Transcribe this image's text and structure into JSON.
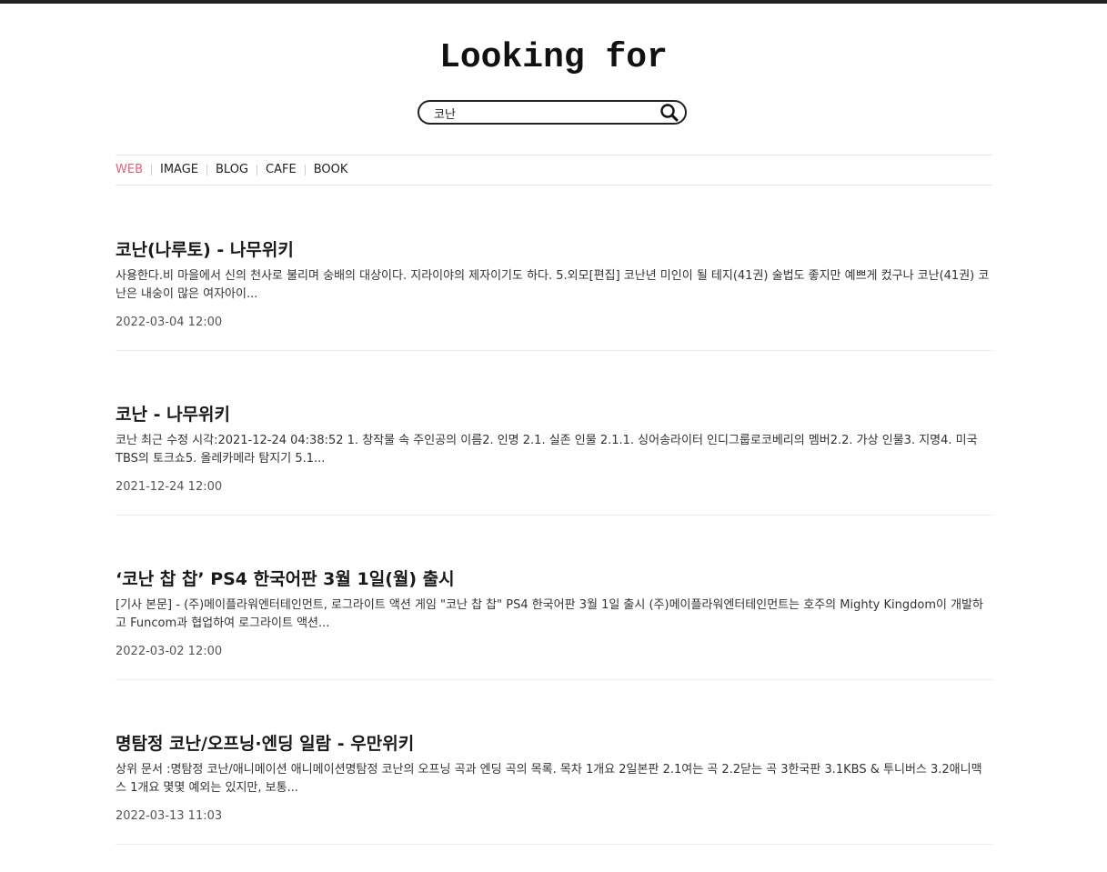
{
  "header": {
    "logo": "Looking for"
  },
  "search": {
    "value": "코난",
    "icon": "search-icon"
  },
  "tabs": [
    {
      "label": "WEB",
      "active": true
    },
    {
      "label": "IMAGE",
      "active": false
    },
    {
      "label": "BLOG",
      "active": false
    },
    {
      "label": "CAFE",
      "active": false
    },
    {
      "label": "BOOK",
      "active": false
    }
  ],
  "colors": {
    "active_tab": "#e0607e",
    "top_border": "#222222"
  },
  "results": [
    {
      "title": "코난(나루토) - 나무위키",
      "snippet": "사용한다.비 마을에서 신의 천사로 불리며 숭배의 대상이다. 지라이야의 제자이기도 하다. 5.외모[편집] 코난년 미인이 될 테지(41권) 술법도 좋지만 예쁘게 컸구나 코난(41권) 코난은 내숭이 많은 여자아이...",
      "date": "2022-03-04 12:00"
    },
    {
      "title": "코난 - 나무위키",
      "snippet": "코난 최근 수정 시각:2021-12-24 04:38:52 1. 창작물 속 주인공의 이름2. 인명 2.1. 실존 인물 2.1.1. 싱어송라이터 인디그룹로코베리의 멤버2.2. 가상 인물3. 지명4. 미국 TBS의 토크쇼5. 올레카메라 탐지기 5.1...",
      "date": "2021-12-24 12:00"
    },
    {
      "title": "‘코난 찹 찹’ PS4 한국어판 3월 1일(월) 출시",
      "snippet": "[기사 본문] - (주)메이플라워엔터테인먼트, 로그라이트 액션 게임 \"코난 찹 찹\" PS4 한국어판 3월 1일 출시 (주)메이플라워엔터테인먼트는 호주의 Mighty Kingdom이 개발하고 Funcom과 협업하여 로그라이트 액션...",
      "date": "2022-03-02 12:00"
    },
    {
      "title": "명탐정 코난/오프닝·엔딩 일람 - 우만위키",
      "snippet": "상위 문서 :명탐정 코난/애니메이션 애니메이션명탐정 코난의 오프닝 곡과 엔딩 곡의 목록. 목차 1개요 2일본판 2.1여는 곡 2.2닫는 곡 3한국판 3.1KBS & 투니버스 3.2애니맥스 1개요 몇몇 예외는 있지만, 보통...",
      "date": "2022-03-13 11:03"
    }
  ]
}
